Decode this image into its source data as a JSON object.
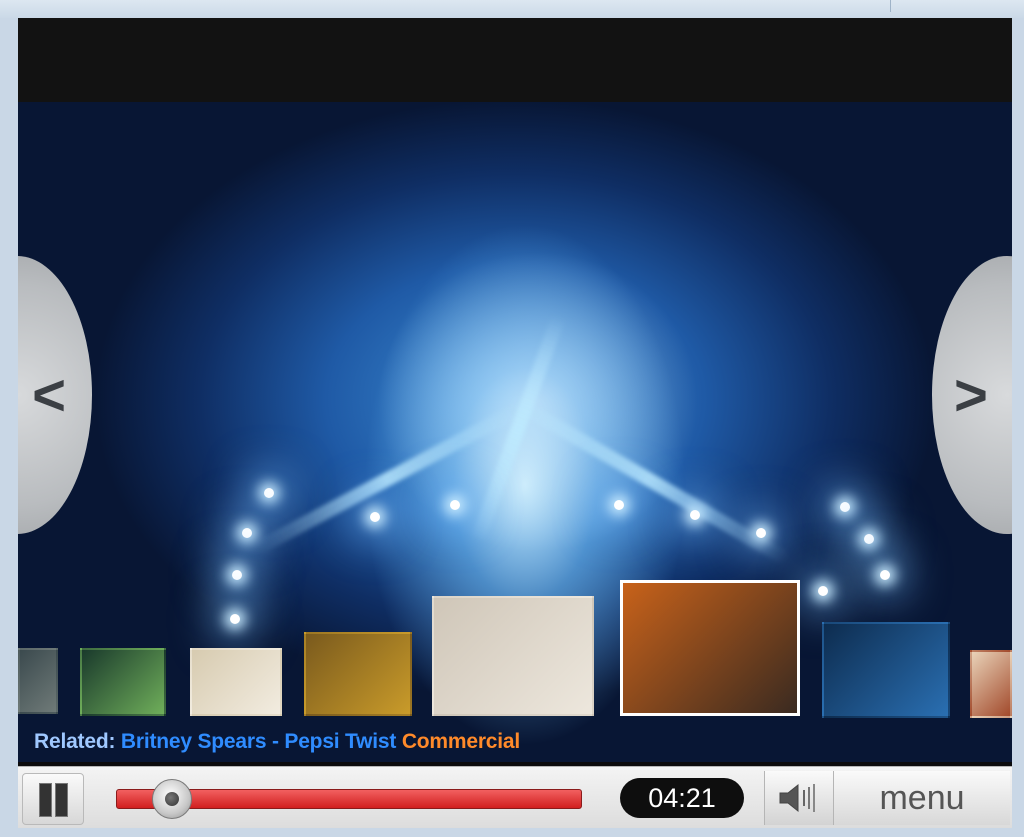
{
  "player": {
    "related_label": "Related:",
    "related_title": "Britney Spears - Pepsi Twist",
    "related_title_end": "Commercial",
    "nav_prev_glyph": "<",
    "nav_next_glyph": ">",
    "time_display": "04:21",
    "menu_label": "menu",
    "progress_fraction": 0.12,
    "accent_color": "#d11f1f"
  },
  "icons": {
    "pause": "pause-icon",
    "volume": "speaker-icon",
    "prev": "chevron-left-icon",
    "next": "chevron-right-icon"
  },
  "related_thumbnails": [
    {
      "id": 1,
      "colors": [
        "#3b4a4e",
        "#6f7a78"
      ]
    },
    {
      "id": 2,
      "colors": [
        "#1a3a2c",
        "#6fae5a"
      ]
    },
    {
      "id": 3,
      "colors": [
        "#d7cbb0",
        "#f2ece0"
      ]
    },
    {
      "id": 4,
      "colors": [
        "#7a5a1d",
        "#c99b2a"
      ]
    },
    {
      "id": 5,
      "colors": [
        "#cfc6b8",
        "#ede7dd"
      ]
    },
    {
      "id": 6,
      "colors": [
        "#c8621a",
        "#3a2a20"
      ],
      "selected": true
    },
    {
      "id": 7,
      "colors": [
        "#0d2c4f",
        "#2a6fb2"
      ]
    },
    {
      "id": 8,
      "colors": [
        "#e9d2b8",
        "#a24a2c"
      ]
    }
  ]
}
